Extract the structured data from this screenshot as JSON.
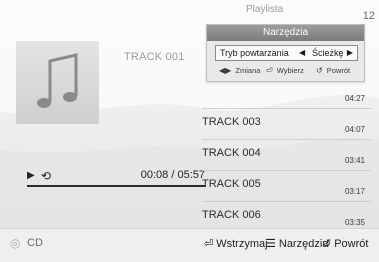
{
  "header": {
    "playlist_label": "Playlista",
    "top_right_number": "12"
  },
  "now_playing": {
    "track_title": "TRACK 001",
    "time": "00:08 / 05:57",
    "icons": [
      "play-icon",
      "repeat-icon"
    ]
  },
  "tracklist": {
    "items": [
      {
        "name": "",
        "duration": "04:27"
      },
      {
        "name": "TRACK 003",
        "duration": "04:07"
      },
      {
        "name": "TRACK 004",
        "duration": "03:41"
      },
      {
        "name": "TRACK 005",
        "duration": "03:17"
      },
      {
        "name": "TRACK 006",
        "duration": "03:35"
      }
    ]
  },
  "tools_popup": {
    "title": "Narzędzia",
    "option_label": "Tryb powtarzania",
    "option_value": "Ścieżkę",
    "hint_change": "Zmiana",
    "hint_select": "Wybierz",
    "hint_return": "Powrót"
  },
  "footer": {
    "source_label": "CD",
    "pause_label": "Wstrzymaj",
    "tools_label": "Narzędzia",
    "back_label": "Powrót"
  }
}
